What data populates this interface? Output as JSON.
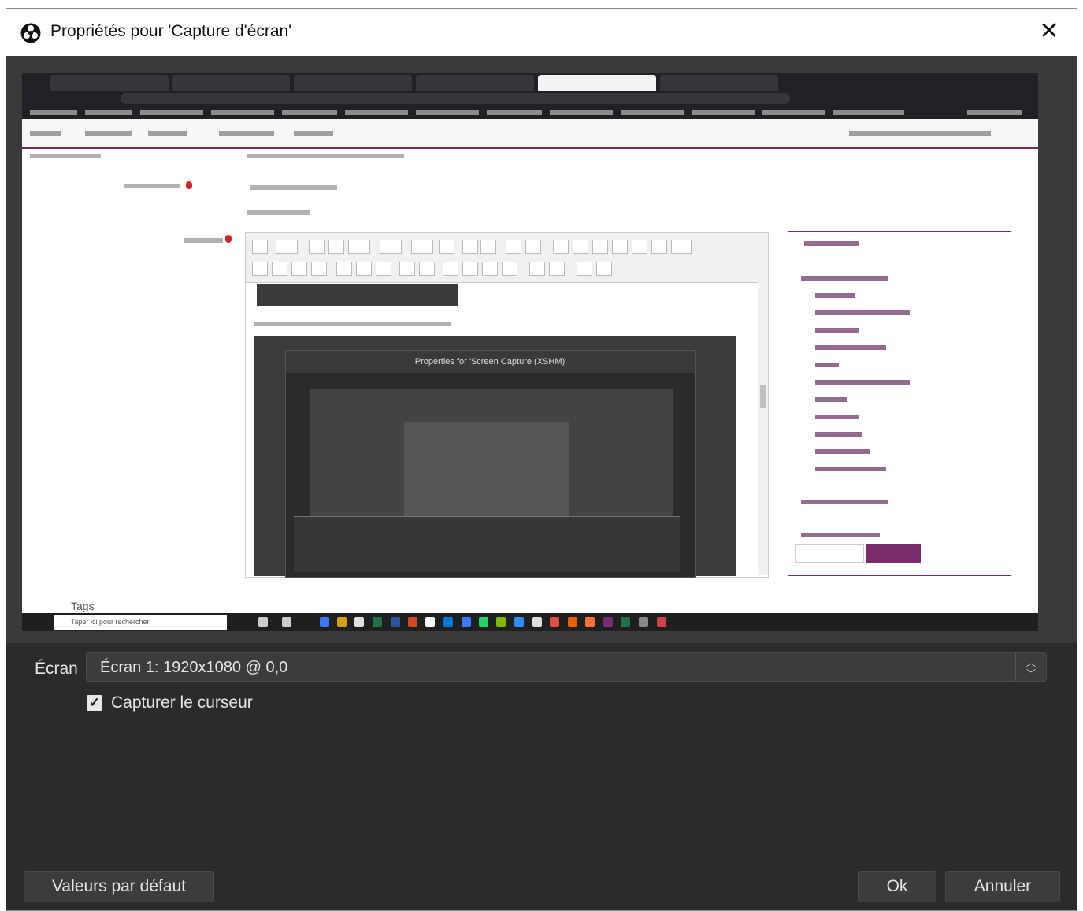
{
  "window": {
    "title": "Propriétés pour 'Capture d'écran'",
    "app_icon": "obs-icon",
    "close_icon": "close-icon"
  },
  "preview": {
    "inner_dialog_title": "Properties for 'Screen Capture (XSHM)'",
    "tags_label": "Tags",
    "taskbar_search_placeholder": "Taper ici pour rechercher"
  },
  "form": {
    "screen_label": "Écran",
    "screen_value": "Écran 1: 1920x1080 @ 0,0",
    "capture_cursor_label": "Capturer le curseur",
    "capture_cursor_checked": true
  },
  "buttons": {
    "defaults": "Valeurs par défaut",
    "ok": "Ok",
    "cancel": "Annuler"
  },
  "colors": {
    "background": "#2b2b2b",
    "control": "#3c3c3c",
    "accent": "#7b2c6e"
  }
}
